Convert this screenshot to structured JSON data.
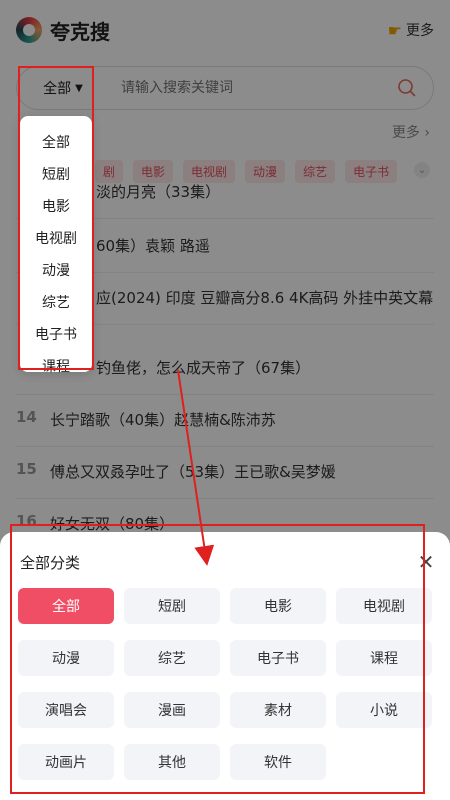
{
  "header": {
    "title": "夸克搜",
    "more": "更多"
  },
  "search": {
    "category": "全部",
    "placeholder": "请输入搜索关键词"
  },
  "hot": {
    "more": "更多 ›"
  },
  "tags": [
    "剧",
    "电影",
    "电视剧",
    "动漫",
    "综艺",
    "电子书"
  ],
  "ranks": [
    {
      "num": "",
      "text": "淡的月亮（33集）"
    },
    {
      "num": "",
      "text": "60集）袁颖 路遥"
    },
    {
      "num": "",
      "text": "应(2024) 印度 豆瓣高分8.6 4K高码 外挂中英文幕"
    },
    {
      "num": "",
      "text": "钓鱼佬，怎么成天帝了（67集）"
    },
    {
      "num": "14",
      "text": "长宁踏歌（40集）赵慧楠&陈沛苏"
    },
    {
      "num": "15",
      "text": "傅总又双叒孕吐了（53集）王已歌&吴梦媛"
    },
    {
      "num": "16",
      "text": "好女无双（80集）"
    }
  ],
  "dropdown": [
    "全部",
    "短剧",
    "电影",
    "电视剧",
    "动漫",
    "综艺",
    "电子书",
    "课程"
  ],
  "sheet": {
    "title": "全部分类",
    "categories": [
      "全部",
      "短剧",
      "电影",
      "电视剧",
      "动漫",
      "综艺",
      "电子书",
      "课程",
      "演唱会",
      "漫画",
      "素材",
      "小说",
      "动画片",
      "其他",
      "软件"
    ]
  },
  "colors": {
    "accent": "#f04e64",
    "annotation": "#e01f1f"
  }
}
